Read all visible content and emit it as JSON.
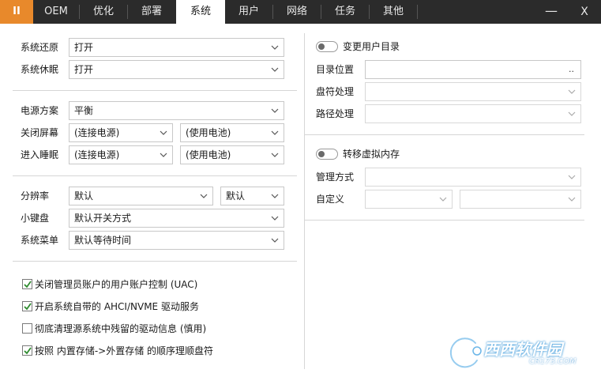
{
  "titlebar": {
    "pause_label": "II",
    "tabs": [
      {
        "label": "OEM"
      },
      {
        "label": "优化"
      },
      {
        "label": "部署"
      },
      {
        "label": "系统"
      },
      {
        "label": "用户"
      },
      {
        "label": "网络"
      },
      {
        "label": "任务"
      },
      {
        "label": "其他"
      }
    ],
    "active_tab": "系统",
    "minimize_label": "—",
    "close_label": "X"
  },
  "left": {
    "restore": {
      "label": "系统还原",
      "value": "打开"
    },
    "hibernate": {
      "label": "系统休眠",
      "value": "打开"
    },
    "power_plan": {
      "label": "电源方案",
      "value": "平衡"
    },
    "screen_off": {
      "label": "关闭屏幕",
      "ac_value": "(连接电源)",
      "battery_value": "(使用电池)"
    },
    "sleep": {
      "label": "进入睡眠",
      "ac_value": "(连接电源)",
      "battery_value": "(使用电池)"
    },
    "resolution": {
      "label": "分辨率",
      "value": "默认",
      "refresh_value": "默认"
    },
    "keypad": {
      "label": "小键盘",
      "value": "默认开关方式"
    },
    "menu": {
      "label": "系统菜单",
      "value": "默认等待时间"
    },
    "checks": [
      {
        "label": "关闭管理员账户的用户账户控制 (UAC)",
        "checked": true
      },
      {
        "label": "开启系统自带的 AHCI/NVME 驱动服务",
        "checked": true
      },
      {
        "label": "彻底清理源系统中残留的驱动信息 (慎用)",
        "checked": false
      },
      {
        "label": "按照 内置存储->外置存储 的顺序理顺盘符",
        "checked": true
      }
    ]
  },
  "right": {
    "user_dir": {
      "toggle_label": "变更用户目录",
      "toggle_on": false
    },
    "dir_location": {
      "label": "目录位置",
      "value": "",
      "browse_label": ".."
    },
    "drive_handling": {
      "label": "盘符处理",
      "value": ""
    },
    "path_handling": {
      "label": "路径处理",
      "value": ""
    },
    "virtual_memory": {
      "toggle_label": "转移虚拟内存",
      "toggle_on": false
    },
    "manage_mode": {
      "label": "管理方式",
      "value": ""
    },
    "custom": {
      "label": "自定义",
      "value1": "",
      "value2": ""
    }
  },
  "watermark": {
    "text": "西西软件园",
    "sub": "CR173.COM"
  },
  "colors": {
    "accent": "#e8892b",
    "titlebar": "#2b2b2b",
    "checkbox_green": "#2e8b2e"
  }
}
